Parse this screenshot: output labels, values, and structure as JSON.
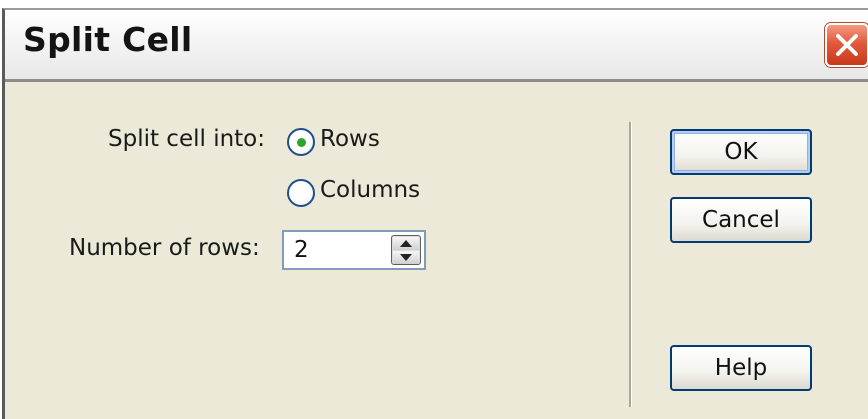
{
  "dialog": {
    "title": "Split Cell"
  },
  "form": {
    "split_label": "Split cell into:",
    "options": [
      {
        "label": "Rows",
        "selected": true
      },
      {
        "label": "Columns",
        "selected": false
      }
    ],
    "number_label": "Number of rows:",
    "number_value": "2"
  },
  "buttons": {
    "ok": "OK",
    "cancel": "Cancel",
    "help": "Help"
  },
  "icons": {
    "close": "close-icon",
    "spin_up": "arrow-up-icon",
    "spin_down": "arrow-down-icon"
  },
  "colors": {
    "dialog_bg": "#ece9d8",
    "close_button": "#e2593b",
    "radio_selected": "#2fa32f",
    "button_border": "#003c74"
  }
}
